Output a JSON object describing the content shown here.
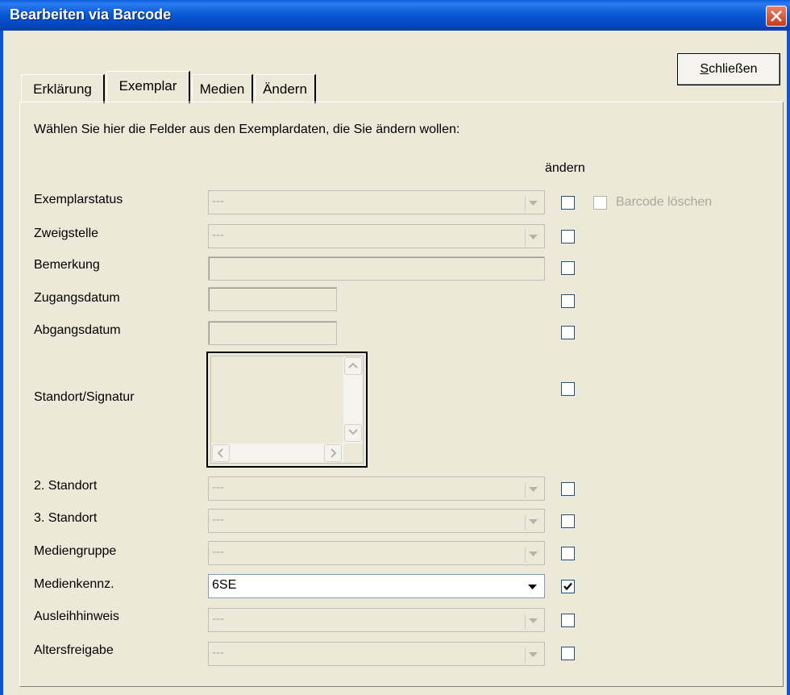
{
  "window": {
    "title": "Bearbeiten via Barcode"
  },
  "close_button": {
    "label": "Schließen",
    "accel": "S",
    "rest": "chließen"
  },
  "tabs": [
    {
      "label": "Erklärung",
      "active": false
    },
    {
      "label": "Exemplar",
      "active": true
    },
    {
      "label": "Medien",
      "active": false
    },
    {
      "label": "Ändern",
      "active": false
    }
  ],
  "instruction": "Wählen Sie hier die Felder aus den Exemplardaten, die Sie ändern wollen:",
  "column_header": "ändern",
  "barcode_delete": {
    "label": "Barcode löschen",
    "checked": false,
    "enabled": false
  },
  "fields": {
    "exemplarstatus": {
      "label": "Exemplarstatus",
      "value": "---",
      "changed": false
    },
    "zweigstelle": {
      "label": "Zweigstelle",
      "value": "---",
      "changed": false
    },
    "bemerkung": {
      "label": "Bemerkung",
      "value": "",
      "changed": false
    },
    "zugangsdatum": {
      "label": "Zugangsdatum",
      "value": "",
      "changed": false
    },
    "abgangsdatum": {
      "label": "Abgangsdatum",
      "value": "",
      "changed": false
    },
    "standort_signatur": {
      "label": "Standort/Signatur",
      "value": "",
      "changed": false
    },
    "standort2": {
      "label": "2. Standort",
      "value": "---",
      "changed": false
    },
    "standort3": {
      "label": "3. Standort",
      "value": "---",
      "changed": false
    },
    "mediengruppe": {
      "label": "Mediengruppe",
      "value": "---",
      "changed": false
    },
    "medienkennz": {
      "label": "Medienkennz.",
      "value": "6SE",
      "changed": true
    },
    "ausleihhinweis": {
      "label": "Ausleihhinweis",
      "value": "---",
      "changed": false
    },
    "altersfreigabe": {
      "label": "Altersfreigabe",
      "value": "---",
      "changed": false
    }
  }
}
